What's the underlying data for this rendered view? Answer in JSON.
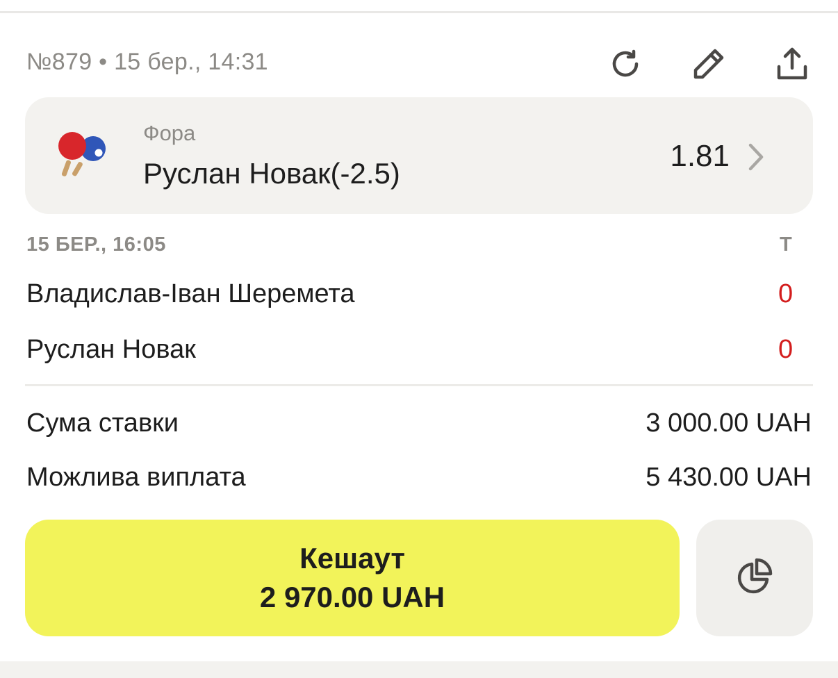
{
  "header": {
    "bet_meta": "№879 • 15 бер., 14:31",
    "icons": [
      "refresh-icon",
      "pencil-icon",
      "share-icon"
    ]
  },
  "selection": {
    "sport_icon": "table-tennis-icon",
    "market": "Фора",
    "name": "Руслан Новак(-2.5)",
    "odds": "1.81"
  },
  "match": {
    "time": "15 БЕР., 16:05",
    "score_column": "Т",
    "players": [
      {
        "name": "Владислав-Іван Шеремета",
        "score": "0"
      },
      {
        "name": "Руслан Новак",
        "score": "0"
      }
    ]
  },
  "summary": {
    "stake_label": "Сума ставки",
    "stake_value": "3 000.00 UAH",
    "payout_label": "Можлива виплата",
    "payout_value": "5 430.00 UAH"
  },
  "cashout": {
    "label": "Кешаут",
    "amount": "2 970.00 UAH",
    "partial_icon": "pie-chart-icon"
  },
  "colors": {
    "accent_yellow": "#f2f35a",
    "card_bg": "#f3f2ef",
    "muted_text": "#8c8a86",
    "score_red": "#d31d1d"
  }
}
